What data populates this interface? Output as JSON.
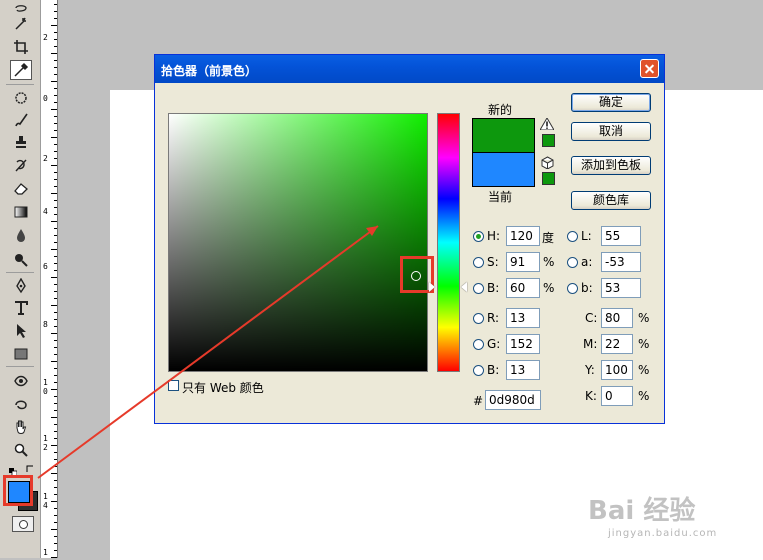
{
  "dialog": {
    "title": "拾色器（前景色）",
    "new_label": "新的",
    "current_label": "当前",
    "buttons": {
      "ok": "确定",
      "cancel": "取消",
      "add_to_swatches": "添加到色板",
      "color_libraries": "颜色库"
    },
    "only_web_colors": "只有 Web 颜色",
    "new_color": "#0d980d",
    "current_color": "#1f87ff",
    "hsb": {
      "h_label": "H:",
      "h_value": "120",
      "h_unit": "度",
      "s_label": "S:",
      "s_value": "91",
      "s_unit": "%",
      "b_label": "B:",
      "b_value": "60",
      "b_unit": "%"
    },
    "rgb": {
      "r_label": "R:",
      "r_value": "13",
      "g_label": "G:",
      "g_value": "152",
      "b_label": "B:",
      "b_value": "13"
    },
    "lab": {
      "l_label": "L:",
      "l_value": "55",
      "a_label": "a:",
      "a_value": "-53",
      "b_label": "b:",
      "b_value": "53"
    },
    "cmyk": {
      "c_label": "C:",
      "c_value": "80",
      "c_unit": "%",
      "m_label": "M:",
      "m_value": "22",
      "m_unit": "%",
      "y_label": "Y:",
      "y_value": "100",
      "y_unit": "%",
      "k_label": "K:",
      "k_value": "0",
      "k_unit": "%"
    },
    "hex_label": "#",
    "hex_value": "0d980d",
    "selected_mode": "H"
  },
  "toolbox": {
    "foreground_color": "#1f87ff",
    "background_color": "#2e2e2e",
    "active_tool": "eyedropper-tool"
  },
  "ruler": {
    "labels": [
      "2",
      "0",
      "2",
      "4",
      "6",
      "8",
      "1\n0",
      "1\n2",
      "1\n4",
      "1"
    ]
  },
  "watermark": {
    "logo": "Bai 经验",
    "site": "jingyan.baidu.com"
  },
  "colors": {
    "highlight": "#e63a2a",
    "title_bar": "#0453d8"
  }
}
